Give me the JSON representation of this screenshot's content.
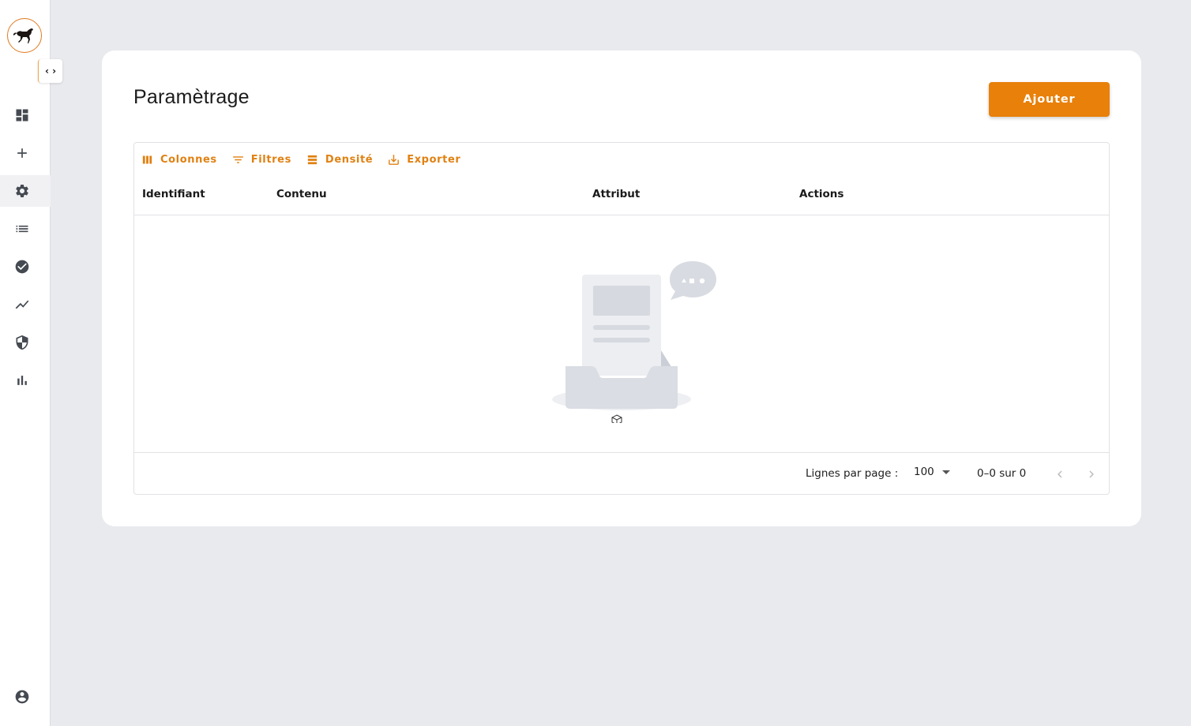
{
  "sidebar": {
    "toggle_label": "‹ ›",
    "items": [
      {
        "icon": "dashboard-icon"
      },
      {
        "icon": "plus-icon"
      },
      {
        "icon": "gear-icon",
        "active": true
      },
      {
        "icon": "list-icon"
      },
      {
        "icon": "check-circle-icon"
      },
      {
        "icon": "trend-line-icon"
      },
      {
        "icon": "shield-icon"
      },
      {
        "icon": "bar-chart-icon"
      }
    ],
    "user_icon": "account-circle-icon"
  },
  "page": {
    "title": "Paramètrage",
    "add_button": "Ajouter"
  },
  "toolbar": {
    "columns": "Colonnes",
    "filters": "Filtres",
    "density": "Densité",
    "export": "Exporter"
  },
  "table": {
    "columns": [
      "Identifiant",
      "Contenu",
      "Attribut",
      "Actions"
    ],
    "rows": []
  },
  "footer": {
    "rows_per_page_label": "Lignes par page :",
    "rows_per_page_value": "100",
    "range": "0–0 sur 0"
  },
  "colors": {
    "accent": "#e8800a",
    "background": "#e9eaee",
    "sidebar_icon": "#454a52"
  }
}
